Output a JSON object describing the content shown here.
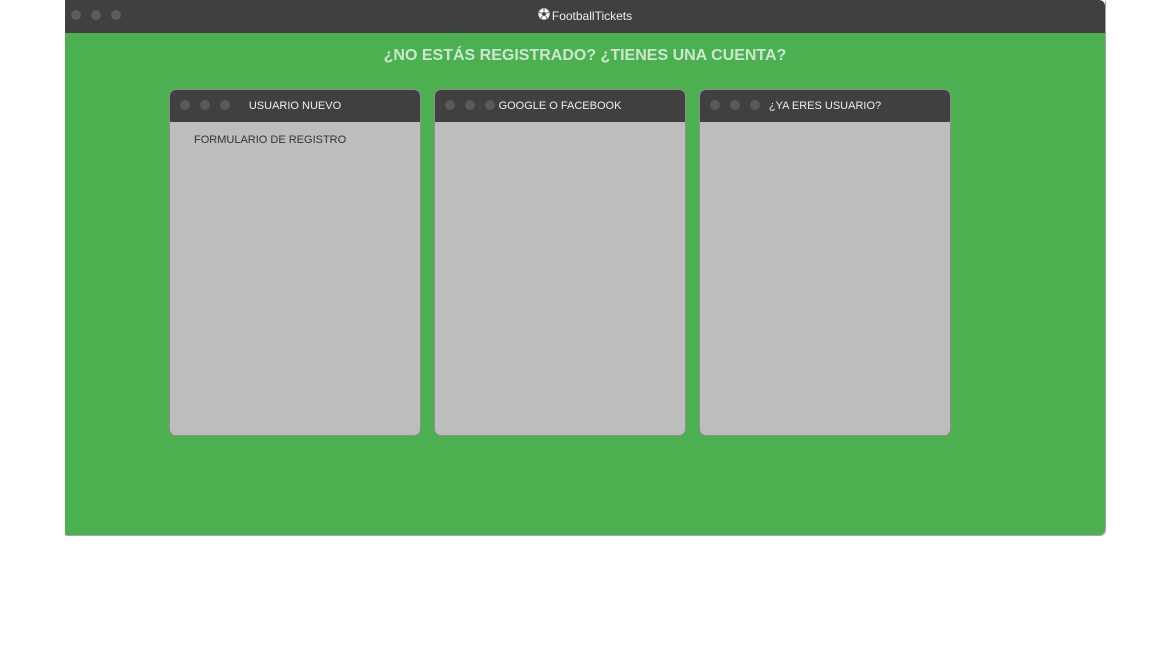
{
  "window": {
    "title": "FootballTickets",
    "title_icon": "soccer-ball-icon"
  },
  "main": {
    "heading": "¿NO ESTÁS REGISTRADO? ¿TIENES UNA CUENTA?"
  },
  "cards": [
    {
      "title": "USUARIO NUEVO",
      "body": "FORMULARIO DE REGISTRO"
    },
    {
      "title": "GOOGLE O FACEBOOK",
      "body": ""
    },
    {
      "title": "¿YA ERES USUARIO?",
      "body": ""
    }
  ],
  "colors": {
    "background": "#4caf50",
    "titlebar": "#404040",
    "card": "#bdbdbd",
    "heading": "#cde7ce"
  }
}
